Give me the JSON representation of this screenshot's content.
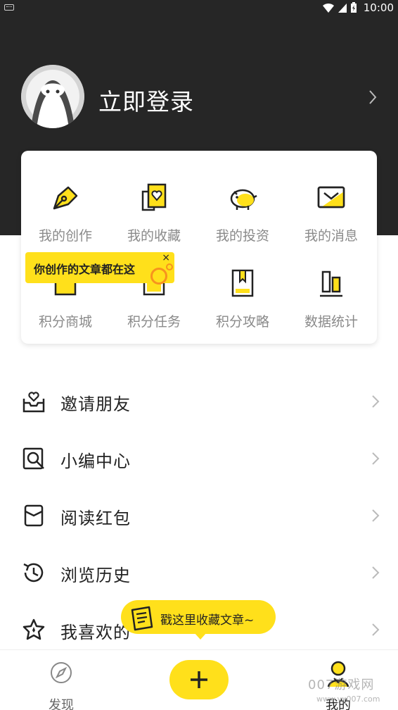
{
  "status_bar": {
    "time": "10:00"
  },
  "profile": {
    "login_label": "立即登录"
  },
  "grid": [
    {
      "label": "我的创作",
      "icon": "pen-icon"
    },
    {
      "label": "我的收藏",
      "icon": "favorites-icon"
    },
    {
      "label": "我的投资",
      "icon": "piggy-bank-icon"
    },
    {
      "label": "我的消息",
      "icon": "message-icon"
    },
    {
      "label": "积分商城",
      "icon": "mall-icon"
    },
    {
      "label": "积分任务",
      "icon": "task-icon"
    },
    {
      "label": "积分攻略",
      "icon": "guide-book-icon"
    },
    {
      "label": "数据统计",
      "icon": "bar-chart-icon"
    }
  ],
  "tooltip_creation": {
    "text": "你创作的文章都在这",
    "close": "×"
  },
  "menu": [
    {
      "label": "邀请朋友",
      "icon": "invite-icon"
    },
    {
      "label": "小编中心",
      "icon": "editor-search-icon"
    },
    {
      "label": "阅读红包",
      "icon": "red-packet-icon"
    },
    {
      "label": "浏览历史",
      "icon": "history-icon"
    },
    {
      "label": "我喜欢的",
      "icon": "star-icon"
    }
  ],
  "tooltip_collect": {
    "text": "戳这里收藏文章~"
  },
  "tabbar": {
    "discover_label": "发现",
    "mine_label": "我的"
  },
  "watermark": {
    "text": "007游戏网",
    "url": "www.yx007.com"
  },
  "colors": {
    "accent": "#ffe01b",
    "header_bg": "#262626"
  }
}
